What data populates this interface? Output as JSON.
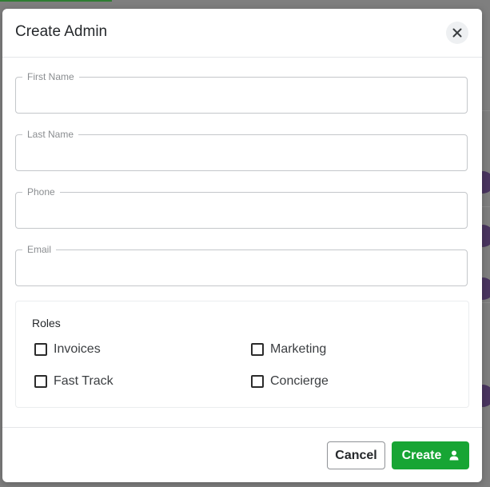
{
  "modal": {
    "title": "Create Admin",
    "close_icon": "close-icon"
  },
  "form": {
    "fields": [
      {
        "id": "first_name",
        "label": "First Name",
        "value": "",
        "placeholder": ""
      },
      {
        "id": "last_name",
        "label": "Last Name",
        "value": "",
        "placeholder": ""
      },
      {
        "id": "phone",
        "label": "Phone",
        "value": "",
        "placeholder": ""
      },
      {
        "id": "email",
        "label": "Email",
        "value": "",
        "placeholder": ""
      }
    ]
  },
  "roles": {
    "title": "Roles",
    "items": [
      {
        "label": "Invoices",
        "checked": false
      },
      {
        "label": "Marketing",
        "checked": false
      },
      {
        "label": "Fast Track",
        "checked": false
      },
      {
        "label": "Concierge",
        "checked": false
      }
    ]
  },
  "footer": {
    "cancel_label": "Cancel",
    "create_label": "Create",
    "create_icon": "user-icon"
  },
  "colors": {
    "primary": "#17a534",
    "backdrop": "#7f7f7f",
    "text": "#25282b"
  }
}
